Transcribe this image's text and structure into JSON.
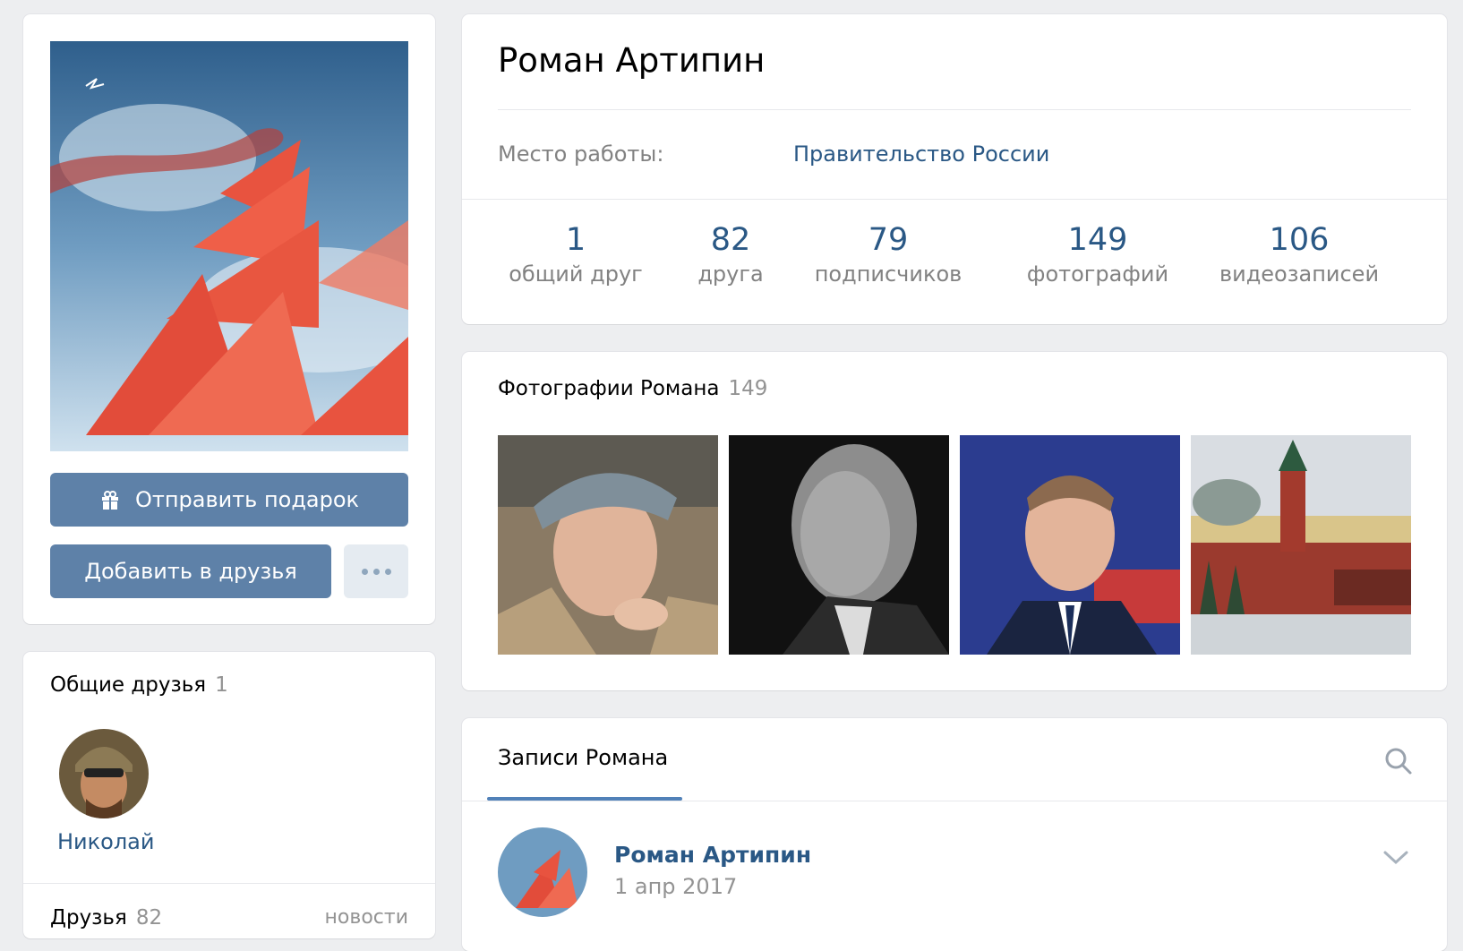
{
  "profile": {
    "name": "Роман Артипин",
    "work_label": "Место работы:",
    "work_value": "Правительство России"
  },
  "actions": {
    "gift_label": "Отправить подарок",
    "add_friend_label": "Добавить в друзья"
  },
  "stats": [
    {
      "value": "1",
      "label": "общий друг"
    },
    {
      "value": "82",
      "label": "друга"
    },
    {
      "value": "79",
      "label": "подписчиков"
    },
    {
      "value": "149",
      "label": "фотографий"
    },
    {
      "value": "106",
      "label": "видеозаписей"
    }
  ],
  "photos": {
    "title": "Фотографии Романа",
    "count": "149"
  },
  "mutual_friends": {
    "title": "Общие друзья",
    "count": "1",
    "friend_name": "Николай"
  },
  "friends": {
    "title": "Друзья",
    "count": "82",
    "news_link": "новости"
  },
  "wall": {
    "tab_label": "Записи Романа",
    "post": {
      "author": "Роман Артипин",
      "date": "1 апр 2017"
    }
  },
  "colors": {
    "accent_button": "#5e81a8",
    "link": "#2a5885",
    "muted": "#828282",
    "background": "#edeef0"
  }
}
